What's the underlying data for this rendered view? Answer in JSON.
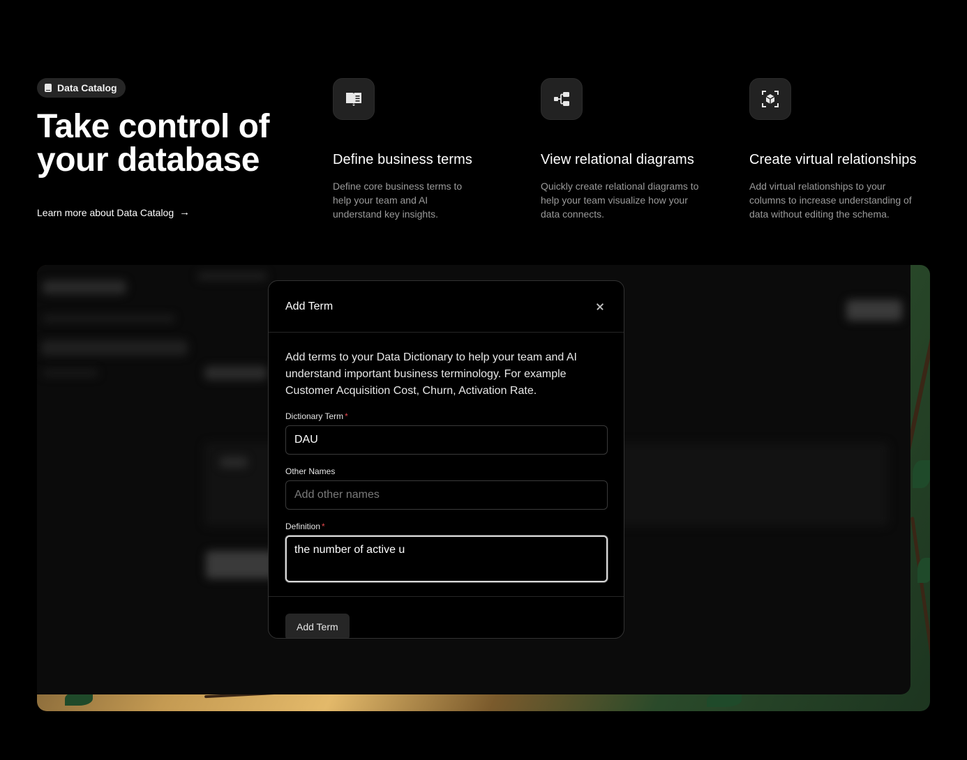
{
  "hero": {
    "badge_label": "Data Catalog",
    "title": "Take control of your database",
    "learn_more": "Learn more about Data Catalog",
    "learn_more_arrow": "→"
  },
  "features": [
    {
      "icon": "book-open-icon",
      "title": "Define business terms",
      "description": "Define core business terms to help your team and AI understand key insights."
    },
    {
      "icon": "diagram-icon",
      "title": "View relational diagrams",
      "description": "Quickly create relational diagrams to help your team visualize how your data connects."
    },
    {
      "icon": "cube-scan-icon",
      "title": "Create virtual relationships",
      "description": "Add virtual relationships to your columns to increase understanding of data without editing the schema."
    }
  ],
  "modal": {
    "title": "Add Term",
    "intro": "Add terms to your Data Dictionary to help your team and AI understand important business terminology. For example Customer Acquisition Cost, Churn, Activation Rate.",
    "fields": {
      "term": {
        "label": "Dictionary Term",
        "required_mark": "*",
        "value": "DAU"
      },
      "other_names": {
        "label": "Other Names",
        "placeholder": "Add other names",
        "value": ""
      },
      "definition": {
        "label": "Definition",
        "required_mark": "*",
        "value": "the number of active u"
      }
    },
    "submit_label": "Add Term"
  },
  "colors": {
    "background": "#000000",
    "surface": "#262626",
    "muted_text": "#9a9a9a",
    "required": "#e5484d"
  }
}
